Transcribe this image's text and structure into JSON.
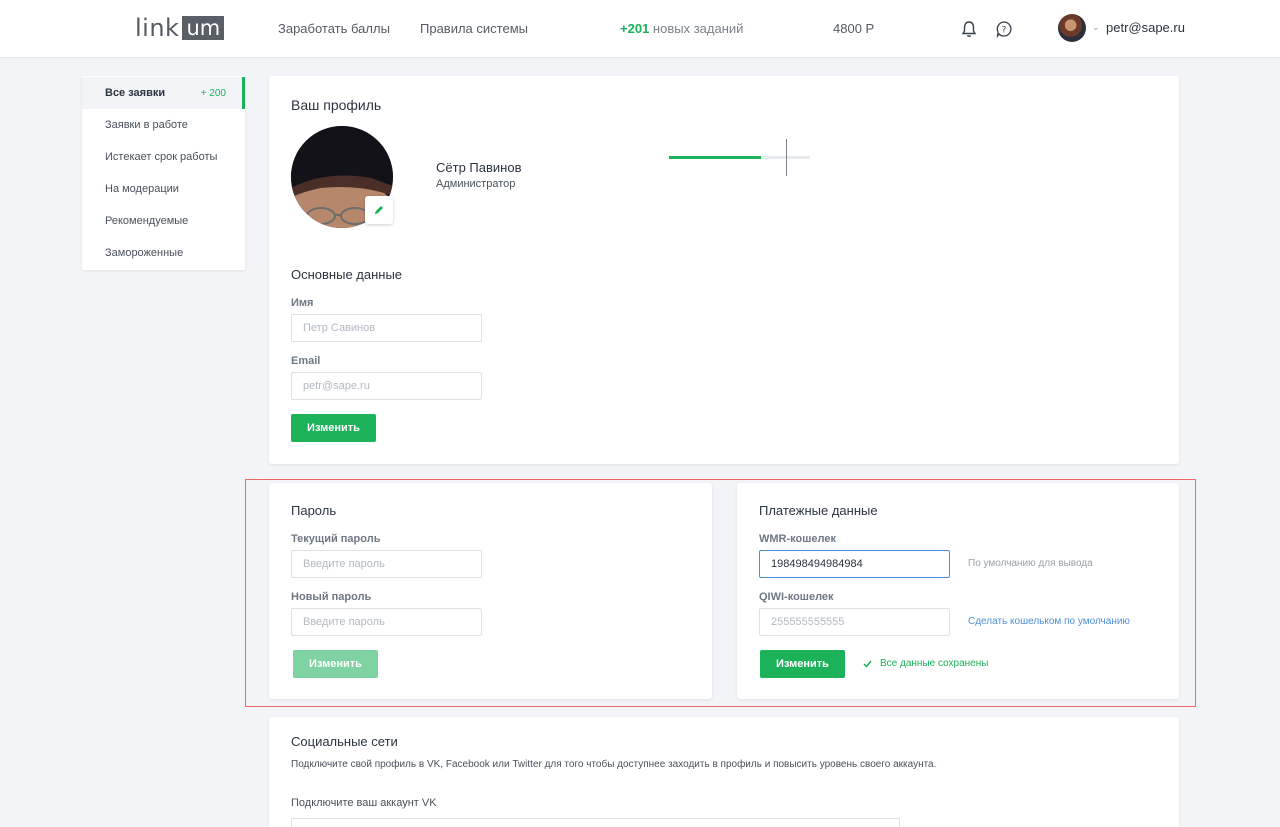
{
  "header": {
    "logo_left": "link",
    "logo_right": "um",
    "nav": [
      "Заработать баллы",
      "Правила системы"
    ],
    "tasks_count": "+201",
    "tasks_label": "новых заданий",
    "balance": "4800 Р",
    "user_email": "petr@sape.ru"
  },
  "sidebar": {
    "items": [
      {
        "label": "Все заявки",
        "count": "+ 200",
        "active": true
      },
      {
        "label": "Заявки в работе"
      },
      {
        "label": "Истекает срок работы"
      },
      {
        "label": "На модерации"
      },
      {
        "label": "Рекомендуемые"
      },
      {
        "label": "Замороженные"
      }
    ]
  },
  "profile": {
    "title": "Ваш профиль",
    "name": "Сётр Павинов",
    "role": "Администратор",
    "progress": 0.65,
    "basic_title": "Основные данные",
    "name_label": "Имя",
    "name_placeholder": "Петр Савинов",
    "email_label": "Email",
    "email_placeholder": "petr@sape.ru",
    "submit": "Изменить"
  },
  "password": {
    "title": "Пароль",
    "current_label": "Текущий пароль",
    "current_placeholder": "Введите пароль",
    "new_label": "Новый пароль",
    "new_placeholder": "Введите пароль",
    "submit": "Изменить"
  },
  "payment": {
    "title": "Платежные данные",
    "wmr_label": "WMR-кошелек",
    "wmr_value": "198498494984984",
    "wmr_hint": "По умолчанию для вывода",
    "qiwi_label": "QIWI-кошелек",
    "qiwi_placeholder": "255555555555",
    "qiwi_link": "Сделать кошельком по умолчанию",
    "submit": "Изменить",
    "saved_text": "Все данные сохранены"
  },
  "social": {
    "title": "Социальные сети",
    "description": "Подключите свой профиль в VK, Facebook или Twitter для того чтобы доступнее заходить в профиль и повысить уровень своего аккаунта.",
    "vk_label": "Подключите ваш аккаунт VK"
  },
  "colors": {
    "accent": "#1bb25a",
    "link": "#4a90d9",
    "highlight": "#ef6b6b"
  }
}
